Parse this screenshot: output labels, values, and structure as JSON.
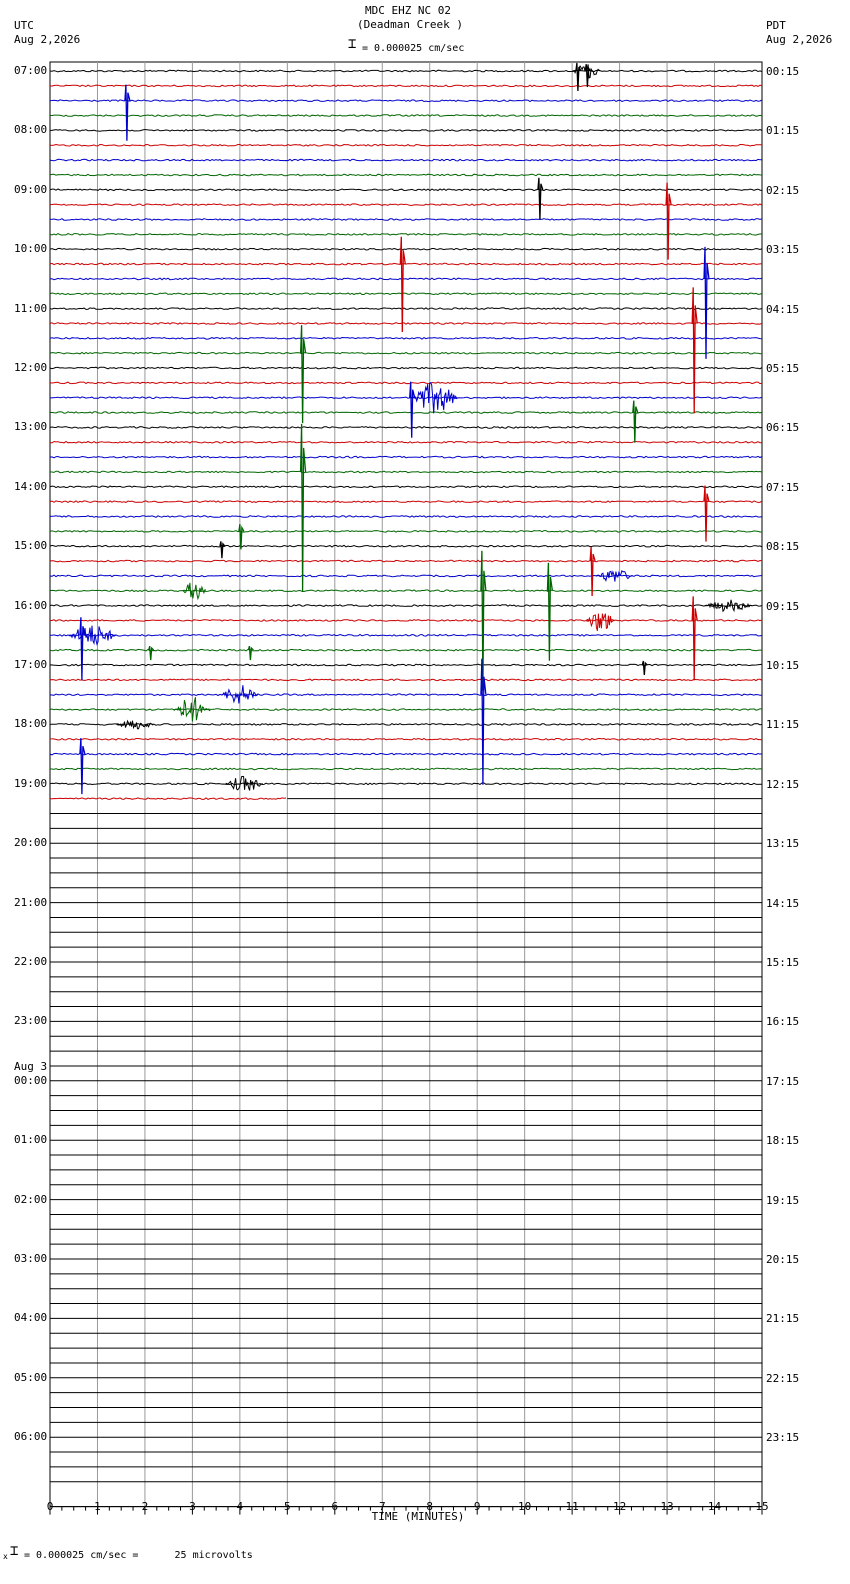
{
  "header": {
    "title": "MDC EHZ NC 02",
    "subtitle": "(Deadman Creek )",
    "scale": "= 0.000025 cm/sec",
    "left_tz": "UTC",
    "left_date": "Aug 2,2026",
    "right_tz": "PDT",
    "right_date": "Aug 2,2026"
  },
  "footer": {
    "scale_note": "= 0.000025 cm/sec =      25 microvolts",
    "prefix": "x"
  },
  "chart_data": {
    "type": "line",
    "xlabel": "TIME (MINUTES)",
    "xlim": [
      0,
      15
    ],
    "x_ticks": [
      "0",
      "1",
      "2",
      "3",
      "4",
      "5",
      "6",
      "7",
      "8",
      "9",
      "10",
      "11",
      "12",
      "13",
      "14",
      "15"
    ],
    "rows_per_hour": 4,
    "total_rows": 96,
    "recorded_rows": 50,
    "last_row_minutes": 5,
    "trace_colors": [
      "#000000",
      "#cc0000",
      "#0000cc",
      "#006600"
    ],
    "utc_hours": [
      "07:00",
      "08:00",
      "09:00",
      "10:00",
      "11:00",
      "12:00",
      "13:00",
      "14:00",
      "15:00",
      "16:00",
      "17:00",
      "18:00",
      "19:00",
      "20:00",
      "21:00",
      "22:00",
      "23:00",
      "00:00",
      "01:00",
      "02:00",
      "03:00",
      "04:00",
      "05:00",
      "06:00"
    ],
    "pdt_hours": [
      "00:15",
      "01:15",
      "02:15",
      "03:15",
      "04:15",
      "05:15",
      "06:15",
      "07:15",
      "08:15",
      "09:15",
      "10:15",
      "11:15",
      "12:15",
      "13:15",
      "14:15",
      "15:15",
      "16:15",
      "17:15",
      "18:15",
      "19:15",
      "20:15",
      "21:15",
      "22:15",
      "23:15"
    ],
    "date_change": {
      "hour_index": 17,
      "label": "Aug 3"
    },
    "spikes": [
      {
        "row": 0,
        "minute": 11.1,
        "amp": 20
      },
      {
        "row": 0,
        "minute": 11.3,
        "amp": 16
      },
      {
        "row": 2,
        "minute": 1.6,
        "amp": 40
      },
      {
        "row": 8,
        "minute": 10.3,
        "amp": 30
      },
      {
        "row": 9,
        "minute": 13.0,
        "amp": 55
      },
      {
        "row": 13,
        "minute": 7.4,
        "amp": 68
      },
      {
        "row": 14,
        "minute": 13.8,
        "amp": 80
      },
      {
        "row": 17,
        "minute": 13.55,
        "amp": 90
      },
      {
        "row": 19,
        "minute": 5.3,
        "amp": 70
      },
      {
        "row": 22,
        "minute": 7.6,
        "amp": 40
      },
      {
        "row": 23,
        "minute": 12.3,
        "amp": 30
      },
      {
        "row": 27,
        "minute": 5.3,
        "amp": 120
      },
      {
        "row": 29,
        "minute": 13.8,
        "amp": 40
      },
      {
        "row": 31,
        "minute": 4.0,
        "amp": 18
      },
      {
        "row": 32,
        "minute": 3.6,
        "amp": 12
      },
      {
        "row": 33,
        "minute": 11.4,
        "amp": 35
      },
      {
        "row": 35,
        "minute": 9.1,
        "amp": 100
      },
      {
        "row": 35,
        "minute": 10.5,
        "amp": 70
      },
      {
        "row": 37,
        "minute": 13.55,
        "amp": 60
      },
      {
        "row": 38,
        "minute": 0.65,
        "amp": 45
      },
      {
        "row": 42,
        "minute": 9.1,
        "amp": 90
      },
      {
        "row": 46,
        "minute": 0.65,
        "amp": 40
      },
      {
        "row": 39,
        "minute": 2.1,
        "amp": 10
      },
      {
        "row": 39,
        "minute": 4.2,
        "amp": 10
      },
      {
        "row": 40,
        "minute": 12.5,
        "amp": 10
      }
    ],
    "bursts": [
      {
        "row": 0,
        "minute": 11.0,
        "width": 0.6,
        "amp": 8
      },
      {
        "row": 22,
        "minute": 7.6,
        "width": 1.0,
        "amp": 16
      },
      {
        "row": 34,
        "minute": 11.5,
        "width": 0.8,
        "amp": 7
      },
      {
        "row": 35,
        "minute": 2.8,
        "width": 0.5,
        "amp": 10
      },
      {
        "row": 36,
        "minute": 13.8,
        "width": 1.0,
        "amp": 6
      },
      {
        "row": 37,
        "minute": 11.3,
        "width": 0.6,
        "amp": 12
      },
      {
        "row": 38,
        "minute": 0.4,
        "width": 1.0,
        "amp": 11
      },
      {
        "row": 42,
        "minute": 3.6,
        "width": 0.8,
        "amp": 10
      },
      {
        "row": 43,
        "minute": 2.6,
        "width": 0.8,
        "amp": 13
      },
      {
        "row": 44,
        "minute": 1.4,
        "width": 0.8,
        "amp": 5
      },
      {
        "row": 48,
        "minute": 3.7,
        "width": 0.8,
        "amp": 8
      }
    ]
  }
}
